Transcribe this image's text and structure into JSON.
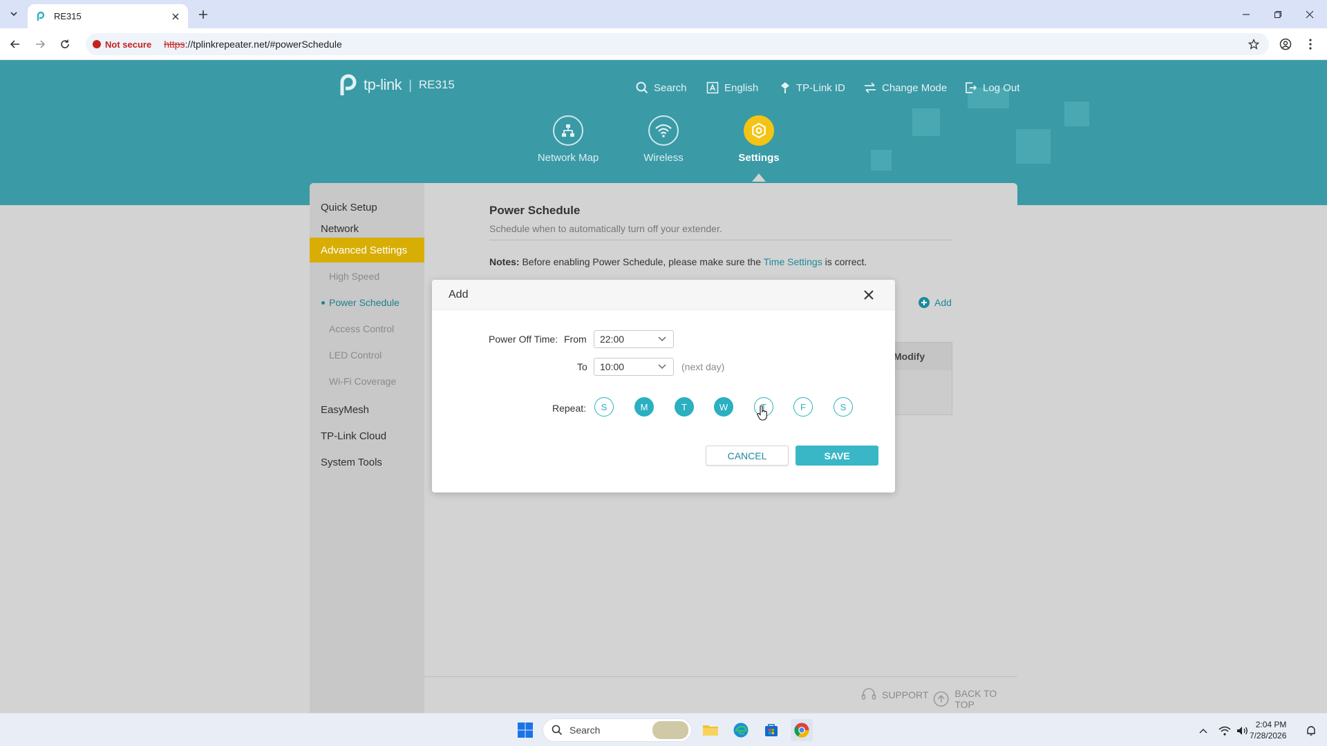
{
  "browser": {
    "tab_title": "RE315",
    "security_label": "Not secure",
    "url_scheme": "https",
    "url_rest": "://tplinkrepeater.net/#powerSchedule"
  },
  "header": {
    "brand": "tp-link",
    "model": "RE315",
    "links": {
      "search": "Search",
      "language": "English",
      "tplink_id": "TP-Link ID",
      "change_mode": "Change Mode",
      "logout": "Log Out"
    },
    "nav": {
      "network_map": "Network Map",
      "wireless": "Wireless",
      "settings": "Settings"
    }
  },
  "sidebar": {
    "items": [
      {
        "label": "Quick Setup"
      },
      {
        "label": "Network"
      },
      {
        "label": "Advanced Settings"
      },
      {
        "label": "High Speed"
      },
      {
        "label": "Power Schedule"
      },
      {
        "label": "Access Control"
      },
      {
        "label": "LED Control"
      },
      {
        "label": "Wi-Fi Coverage"
      },
      {
        "label": "EasyMesh"
      },
      {
        "label": "TP-Link Cloud"
      },
      {
        "label": "System Tools"
      }
    ]
  },
  "content": {
    "title": "Power Schedule",
    "description": "Schedule when to automatically turn off your extender.",
    "notes_label": "Notes:",
    "notes_text": " Before enabling Power Schedule, please make sure the ",
    "notes_link": "Time Settings",
    "notes_end": " is correct.",
    "add_label": "Add",
    "table_header_modify": "Modify"
  },
  "modal": {
    "title": "Add",
    "power_off_label": "Power Off Time:",
    "from_label": "From",
    "from_value": "22:00",
    "to_label": "To",
    "to_value": "10:00",
    "next_day": "(next day)",
    "repeat_label": "Repeat:",
    "days": [
      {
        "letter": "S",
        "selected": false
      },
      {
        "letter": "M",
        "selected": true
      },
      {
        "letter": "T",
        "selected": true
      },
      {
        "letter": "W",
        "selected": true
      },
      {
        "letter": "T",
        "selected": false
      },
      {
        "letter": "F",
        "selected": false
      },
      {
        "letter": "S",
        "selected": false
      }
    ],
    "cancel_label": "CANCEL",
    "save_label": "SAVE"
  },
  "footer": {
    "support": "SUPPORT",
    "back_to_top": "BACK TO TOP"
  },
  "taskbar": {
    "search_placeholder": "Search",
    "time": "2:04 PM",
    "date": "7/28/2026"
  },
  "colors": {
    "accent_teal": "#2ab0c0",
    "banner": "#3a9aa6",
    "settings_yellow": "#f4c414",
    "sidebar_active": "#d8ae05"
  }
}
